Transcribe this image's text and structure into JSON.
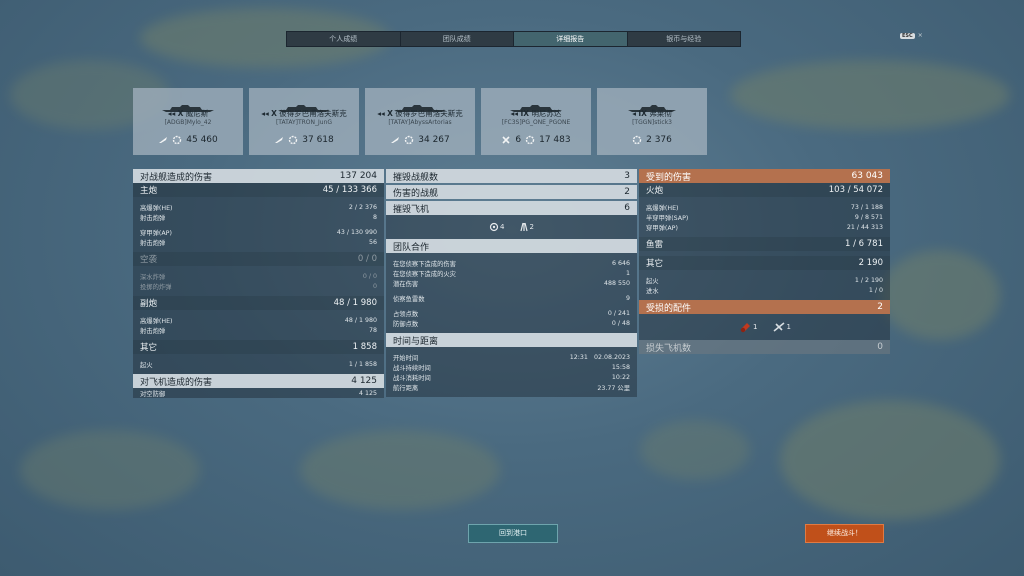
{
  "tabs": [
    {
      "label": "个人成绩",
      "active": false
    },
    {
      "label": "团队成绩",
      "active": false
    },
    {
      "label": "详细报告",
      "active": true
    },
    {
      "label": "银币与经验",
      "active": false
    }
  ],
  "esc": {
    "key": "ESC",
    "close": "×"
  },
  "cards": [
    {
      "tier": "X",
      "ship": "威尼斯",
      "player": "[ADGB]Mylo_42",
      "kills": null,
      "damage": "45 460"
    },
    {
      "tier": "X",
      "ship": "彼得罗巴甫洛夫斯克",
      "player": "[TATAY]TRON_JunG",
      "kills": null,
      "damage": "37 618"
    },
    {
      "tier": "X",
      "ship": "彼得罗巴甫洛夫斯克",
      "player": "[TATAY]AbyssArtorias",
      "kills": null,
      "damage": "34 267"
    },
    {
      "tier": "IX",
      "ship": "明尼苏达",
      "player": "[FC3S]PG_ONE_PGONE",
      "kills": "6",
      "damage": "17 483"
    },
    {
      "tier": "IX",
      "ship": "弗莱彻",
      "player": "[TGGN]stick3",
      "kills": null,
      "damage": "2 376"
    }
  ],
  "left": {
    "ship_damage": {
      "label": "对战舰造成的伤害",
      "value": "137 204"
    },
    "main_battery": {
      "label": "主炮",
      "value": "45 / 133 366"
    },
    "he": {
      "label": "高爆弹(HE)",
      "value": "2 / 2 376"
    },
    "he_fires": {
      "label": "射击炮弹",
      "value": "8"
    },
    "ap": {
      "label": "穿甲弹(AP)",
      "value": "43 / 130 990"
    },
    "ap_fires": {
      "label": "射击炮弹",
      "value": "56"
    },
    "air": {
      "label": "空袭",
      "value": "0 / 0"
    },
    "depth": {
      "label": "深水炸弹",
      "value": "0 / 0"
    },
    "bombs": {
      "label": "投掷的炸弹",
      "value": "0"
    },
    "secondary": {
      "label": "副炮",
      "value": "48 / 1 980"
    },
    "sec_he": {
      "label": "高爆弹(HE)",
      "value": "48 / 1 980"
    },
    "sec_fires": {
      "label": "射击炮弹",
      "value": "78"
    },
    "other": {
      "label": "其它",
      "value": "1 858"
    },
    "fire": {
      "label": "起火",
      "value": "1 / 1 858"
    },
    "plane_damage": {
      "label": "对飞机造成的伤害",
      "value": "4 125"
    },
    "aa": {
      "label": "对空防御",
      "value": "4 125"
    }
  },
  "middle": {
    "ships_destroyed": {
      "label": "摧毁战舰数",
      "value": "3"
    },
    "ships_damaged": {
      "label": "伤害的战舰",
      "value": "2"
    },
    "planes_destroyed": {
      "label": "摧毁飞机",
      "value": "6"
    },
    "plane_icons": [
      {
        "count": "4"
      },
      {
        "count": "2"
      }
    ],
    "teamwork": {
      "label": "团队合作"
    },
    "spot_damage": {
      "label": "在您侦察下造成的伤害",
      "value": "6 646"
    },
    "spot_fires": {
      "label": "在您侦察下造成的火灾",
      "value": "1"
    },
    "potential": {
      "label": "潜在伤害",
      "value": "488 550"
    },
    "torp_spotted": {
      "label": "侦察鱼雷数",
      "value": "9"
    },
    "cap_points": {
      "label": "占领点数",
      "value": "0 / 241"
    },
    "def_points": {
      "label": "防御点数",
      "value": "0 / 48"
    },
    "time": {
      "label": "时间与距离"
    },
    "start": {
      "label": "开始时间",
      "clock": "12:31",
      "date": "02.08.2023"
    },
    "duration": {
      "label": "战斗持续时间",
      "value": "15:58"
    },
    "survived": {
      "label": "战斗消耗时间",
      "value": "10:22"
    },
    "distance": {
      "label": "航行距离",
      "value": "23.77  公里"
    }
  },
  "right": {
    "received": {
      "label": "受到的伤害",
      "value": "63 043"
    },
    "guns": {
      "label": "火炮",
      "value": "103 / 54 072"
    },
    "he": {
      "label": "高爆弹(HE)",
      "value": "73 / 1 188"
    },
    "sap": {
      "label": "半穿甲弹(SAP)",
      "value": "9 / 8 571"
    },
    "ap": {
      "label": "穿甲弹(AP)",
      "value": "21 / 44 313"
    },
    "torpedo": {
      "label": "鱼雷",
      "value": "1 / 6 781"
    },
    "other": {
      "label": "其它",
      "value": "2 190"
    },
    "fire": {
      "label": "起火",
      "value": "1 / 2 190"
    },
    "flood": {
      "label": "进水",
      "value": "1 / 0"
    },
    "modules": {
      "label": "受损的配件",
      "value": "2"
    },
    "module_icons": [
      {
        "count": "1"
      },
      {
        "count": "1"
      }
    ],
    "planes_lost": {
      "label": "损失飞机数",
      "value": "0"
    }
  },
  "buttons": {
    "port": "回到港口",
    "battle": "继续战斗！"
  }
}
